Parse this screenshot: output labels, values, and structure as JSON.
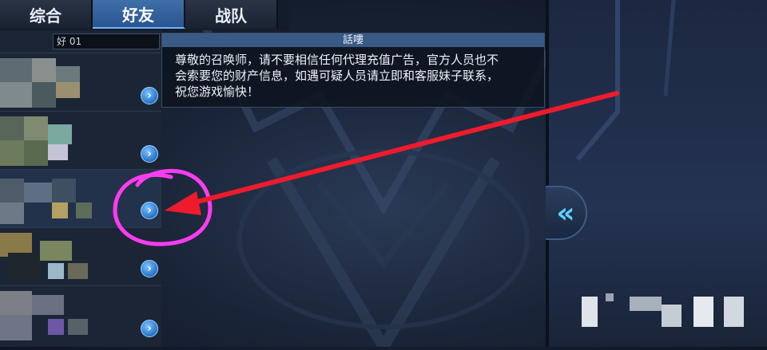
{
  "tabs": [
    {
      "label": "综合",
      "active": false
    },
    {
      "label": "好友",
      "active": true
    },
    {
      "label": "战队",
      "active": false
    }
  ],
  "search": {
    "value": "好    01"
  },
  "friends": [
    {
      "highlight": false
    },
    {
      "highlight": false
    },
    {
      "highlight": true
    },
    {
      "highlight": false
    },
    {
      "highlight": false
    }
  ],
  "message": {
    "title": "話嘍",
    "lines": [
      "尊敬的召唤师，请不要相信任何代理充值广告，官方人员也不",
      "会索要您的财产信息，如遇可疑人员请立即和客服妹子联系，",
      "祝您游戏愉快！"
    ]
  },
  "icons": {
    "friend_arrow": "chevron-right-icon",
    "collapse": "double-chevron-left-icon"
  },
  "annotation": {
    "circle_color": "#ff3cf0",
    "arrow_color": "#ee1b2c"
  }
}
